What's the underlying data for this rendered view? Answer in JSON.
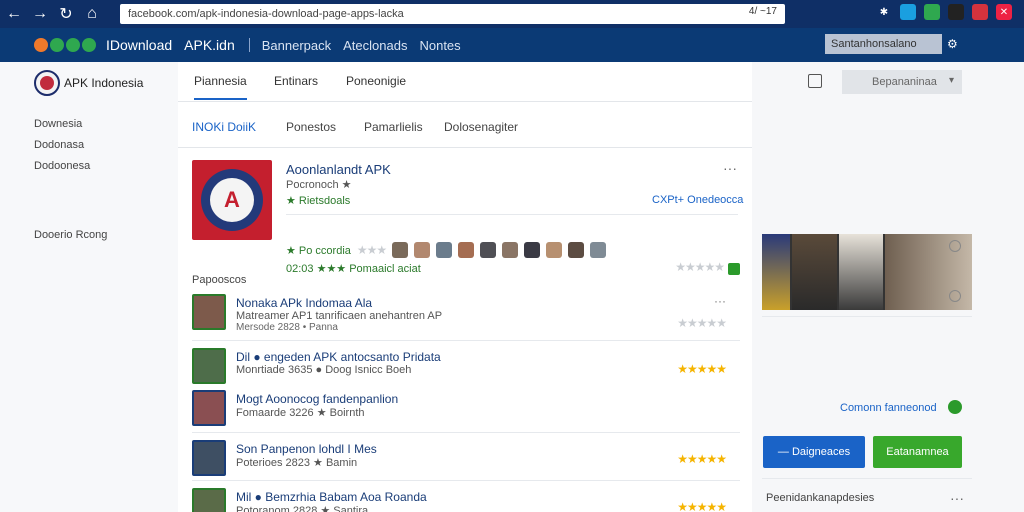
{
  "browser": {
    "url": "facebook.com/apk-indonesia-download-page-apps-lacka",
    "url_right": "4/ ~17",
    "ext_colors": [
      "#fff",
      "#1a9fe0",
      "#2fa84f",
      "#222",
      "#d5333d",
      "#e24"
    ]
  },
  "header": {
    "brand": "IDownload",
    "brand2": "APK.idn",
    "links": [
      "Bannerpack",
      "Ateclonads",
      "Nontes"
    ],
    "search_label": "Santanhonsalano"
  },
  "sidebar": {
    "site_title": "APK Indonesia",
    "items": [
      "Downesia",
      "Dodonasa",
      "Dodoonesa",
      "Dooerio Rcong"
    ]
  },
  "main": {
    "tabs": [
      "Piannesia",
      "Entinars",
      "Poneonigie"
    ],
    "subtabs": [
      "INOKi DoiiK",
      "Ponestos",
      "Pamarlielis",
      "Dolosenagiter"
    ],
    "app": {
      "name": "Aoonlanlandt APK",
      "dev": "Pocronoch ★",
      "rating": "★ Rietsdoals",
      "link": "CXPt+ Onedeocca",
      "more": "···"
    },
    "people_row_1": "★ Po  ccordia",
    "people_row_2": "02:03 ★★★ Pomaaicl aciat",
    "section_label": "Papooscos",
    "list": [
      {
        "title": "Nonaka APk Indomaa Ala",
        "sub": "Matreamer AP1 tanrificaen anehantren AP",
        "meta": "Mersode  2828  •  Panna",
        "stars": "★★★★★",
        "grey": true
      },
      {
        "title": "Dil ● engeden APK antocsanto Pridata",
        "sub": "Monrtiade 3635 ● Doog  Isnicc Boeh",
        "meta": "",
        "stars": "★★★★★",
        "grey": false
      },
      {
        "title": "Mogt Aoonocog fandenpanlion",
        "sub": "Fomaarde 3226 ★ Boirnth",
        "meta": "",
        "stars": "",
        "grey": false
      },
      {
        "title": "Son Panpenon  lohdl I Mes",
        "sub": "Poterioes  2823  ★ Bamin",
        "meta": "",
        "stars": "★★★★★",
        "grey": false
      },
      {
        "title": "Mil ● Bemzrhia  Babam Aoa Roanda",
        "sub": "Potoranom 2828 ★ Santira",
        "meta": "",
        "stars": "★★★★★",
        "grey": false
      }
    ]
  },
  "right": {
    "select_label": "Bepananinaa",
    "link": "Comonn fanneonod",
    "btn_blue": "— Daigneaces",
    "btn_green": "Eatanamnea",
    "footer": "Peenidankanapdesies",
    "more": "···"
  }
}
